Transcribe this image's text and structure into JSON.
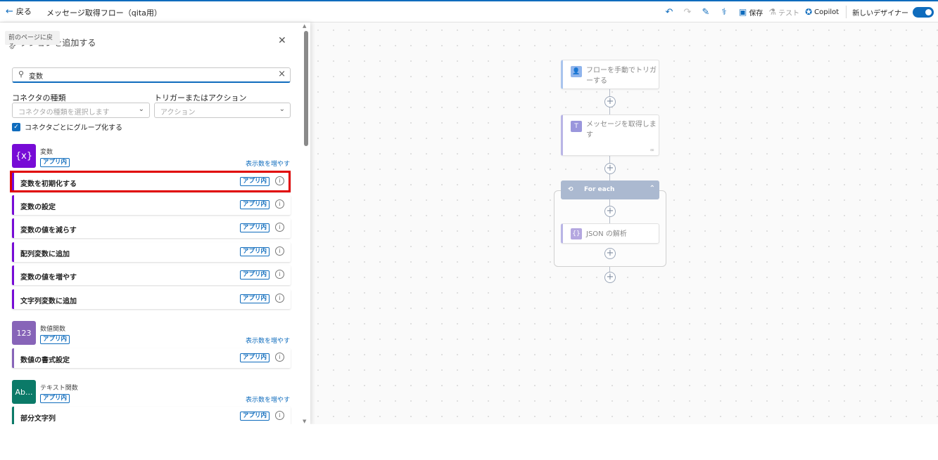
{
  "topbar": {
    "back_label": "戻る",
    "flow_title": "メッセージ取得フロー（qita用）",
    "save_label": "保存",
    "test_label": "テスト",
    "copilot_label": "Copilot",
    "new_designer_label": "新しいデザイナー",
    "new_designer_on": true
  },
  "tooltip": "前のページに戻る",
  "panel": {
    "title": "アクションを追加する",
    "search_value": "変数",
    "connector_type_label": "コネクタの種類",
    "connector_type_placeholder": "コネクタの種類を選択します",
    "trigger_action_label": "トリガーまたはアクション",
    "trigger_action_placeholder": "アクション",
    "group_by_connector_label": "コネクタごとにグループ化する",
    "group_by_connector_checked": true,
    "groups": [
      {
        "name": "変数",
        "icon_text": "{x}",
        "badge": "アプリ内",
        "more": "表示数を増やす",
        "color": "#770bd6",
        "items": [
          {
            "label": "変数を初期化する",
            "badge": "アプリ内"
          },
          {
            "label": "変数の設定",
            "badge": "アプリ内"
          },
          {
            "label": "変数の値を減らす",
            "badge": "アプリ内"
          },
          {
            "label": "配列変数に追加",
            "badge": "アプリ内"
          },
          {
            "label": "変数の値を増やす",
            "badge": "アプリ内"
          },
          {
            "label": "文字列変数に追加",
            "badge": "アプリ内"
          }
        ]
      },
      {
        "name": "数値関数",
        "icon_text": "123",
        "badge": "アプリ内",
        "more": "表示数を増やす",
        "color": "#8764b8",
        "items": [
          {
            "label": "数値の書式設定",
            "badge": "アプリ内"
          }
        ]
      },
      {
        "name": "テキスト関数",
        "icon_text": "Ab...",
        "badge": "アプリ内",
        "more": "表示数を増やす",
        "color": "#0b7a68",
        "items": [
          {
            "label": "部分文字列",
            "badge": "アプリ内"
          }
        ]
      }
    ]
  },
  "canvas": {
    "trigger_card": "フローを手動でトリガーする",
    "teams_card": "メッセージを取得します",
    "foreach_label": "For each",
    "json_card": "JSON の解析"
  },
  "colors": {
    "accent": "#0f6cbd",
    "highlight": "#e00000"
  }
}
